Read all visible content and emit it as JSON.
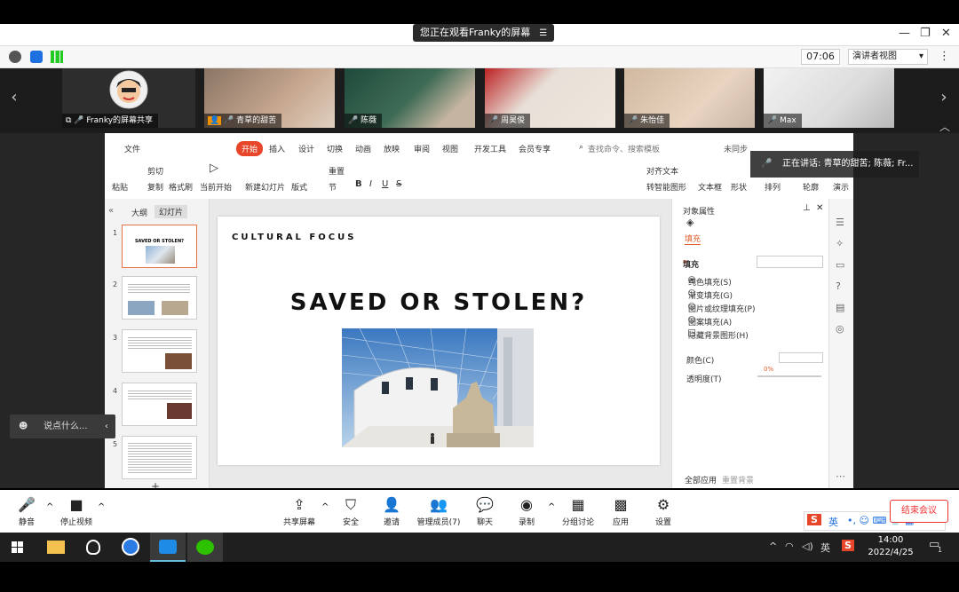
{
  "zoom": {
    "window_title": "您正在观看Franky的屏幕",
    "timer": "07:06",
    "view_mode": "演讲者视图",
    "speaking": "正在讲话: 青草的甜苦; 陈薇; Fr...",
    "chat_placeholder": "说点什么...",
    "participants": [
      {
        "name": "Franky的屏幕共享"
      },
      {
        "name": "青草的甜苦"
      },
      {
        "name": "陈薇"
      },
      {
        "name": "周昊俊"
      },
      {
        "name": "朱怡佳"
      },
      {
        "name": "Max"
      }
    ],
    "toolbar": {
      "mute": "静音",
      "stop_video": "停止视频",
      "share": "共享屏幕",
      "security": "安全",
      "invite": "邀请",
      "manage": "管理成员(7)",
      "chat": "聊天",
      "record": "录制",
      "breakout": "分组讨论",
      "apps": "应用",
      "settings": "设置",
      "end": "结束会议"
    }
  },
  "wps": {
    "tabs": [
      "文件",
      "开始",
      "插入",
      "设计",
      "切换",
      "动画",
      "放映",
      "审阅",
      "视图",
      "开发工具",
      "会员专享"
    ],
    "search": "查找命令、搜索模板",
    "sync": "未同步",
    "ribbon": {
      "paste": "粘贴",
      "cut": "剪切",
      "copy": "复制",
      "format_painter": "格式刷",
      "start_current": "当前开始",
      "new_slide": "新建幻灯片",
      "layout": "版式",
      "section": "节",
      "reset": "重置",
      "align_text": "对齐文本",
      "smart_shape": "转智能图形",
      "textbox": "文本框",
      "shapes": "形状",
      "arrange": "排列",
      "outline": "轮廓",
      "more": "演示"
    },
    "left_tabs": [
      "大纲",
      "幻灯片"
    ],
    "slide_numbers": [
      "1",
      "2",
      "3",
      "4",
      "5"
    ],
    "slide": {
      "kicker": "CULTURAL FOCUS",
      "title": "SAVED OR STOLEN?"
    },
    "props": {
      "header": "对象属性",
      "tab_fill": "填充",
      "section_fill": "填充",
      "options": [
        "纯色填充(S)",
        "渐变填充(G)",
        "图片或纹理填充(P)",
        "图案填充(A)"
      ],
      "hide_bg": "隐藏背景图形(H)",
      "color": "颜色(C)",
      "transparency": "透明度(T)",
      "transparency_value": "0%",
      "apply_all": "全部应用",
      "reset_bg": "重置背景"
    }
  },
  "taskbar": {
    "time": "14:00",
    "date": "2022/4/25",
    "lang": "英",
    "notify_count": "1"
  }
}
